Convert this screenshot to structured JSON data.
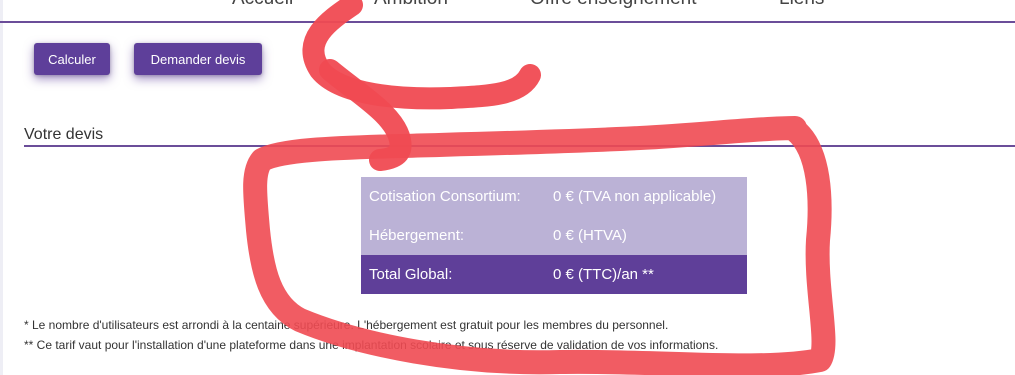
{
  "nav": {
    "items": [
      "Accueil",
      "Ambition",
      "Offre enseignement",
      "Liens"
    ]
  },
  "buttons": {
    "calculate": "Calculer",
    "request_quote": "Demander devis"
  },
  "section": {
    "title": "Votre devis"
  },
  "quote": {
    "rows": [
      {
        "label": "Cotisation Consortium:",
        "value": "0 € (TVA non applicable)"
      },
      {
        "label": "Hébergement:",
        "value": "0 € (HTVA)"
      },
      {
        "label": "Total Global:",
        "value": "0 € (TTC)/an **"
      }
    ]
  },
  "footnotes": {
    "note1": "* Le nombre d'utilisateurs est arrondi à la centaine supérieure. L'hébergement est gratuit pour les membres du personnel.",
    "note2": "** Ce tarif vaut pour l'installation d'une plateforme dans une implantation scolaire et sous réserve de validation de vos informations."
  },
  "colors": {
    "brand_purple": "#5e3f9a",
    "light_purple": "#bbb2d6",
    "annotation_red": "#f04a52"
  }
}
